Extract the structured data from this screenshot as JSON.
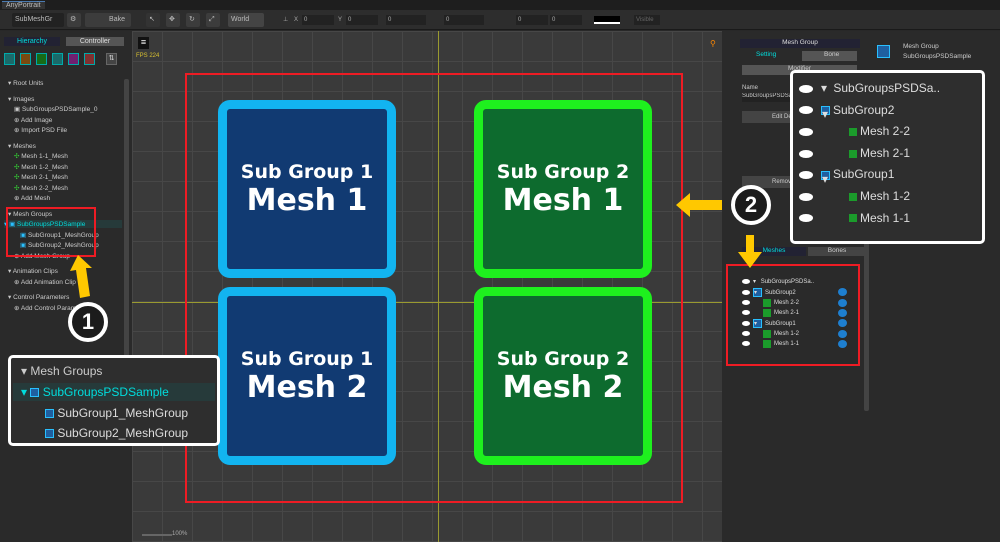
{
  "window": {
    "title": "AnyPortrait"
  },
  "toolbar": {
    "mesh_group_select": "SubMeshGr",
    "bake": "Bake",
    "space": "World",
    "pos_x": "0",
    "pos_y": "0",
    "scale": "0",
    "rotation": "0",
    "size_x": "0",
    "size_y": "0",
    "visible": "Visible",
    "x": "X",
    "y": "Y"
  },
  "left_panel": {
    "tabs": [
      "Hierarchy",
      "Controller"
    ],
    "tree": [
      {
        "label": "Root Units",
        "type": "header"
      },
      {
        "label": "Images",
        "type": "header"
      },
      {
        "label": "SubGroupsPSDSample_0",
        "type": "image"
      },
      {
        "label": "Add Image",
        "type": "add"
      },
      {
        "label": "Import PSD File",
        "type": "add"
      },
      {
        "label": "Meshes",
        "type": "header"
      },
      {
        "label": "Mesh 1-1_Mesh",
        "type": "mesh"
      },
      {
        "label": "Mesh 1-2_Mesh",
        "type": "mesh"
      },
      {
        "label": "Mesh 2-1_Mesh",
        "type": "mesh"
      },
      {
        "label": "Mesh 2-2_Mesh",
        "type": "mesh"
      },
      {
        "label": "Add Mesh",
        "type": "add"
      },
      {
        "label": "Mesh Groups",
        "type": "header"
      },
      {
        "label": "SubGroupsPSDSample",
        "type": "selected"
      },
      {
        "label": "SubGroup1_MeshGroup",
        "type": "meshgroup"
      },
      {
        "label": "SubGroup2_MeshGroup",
        "type": "meshgroup"
      },
      {
        "label": "Add Mesh Group",
        "type": "add"
      },
      {
        "label": "Animation Clips",
        "type": "header"
      },
      {
        "label": "Add Animation Clip",
        "type": "add"
      },
      {
        "label": "Control Parameters",
        "type": "header"
      },
      {
        "label": "Add Control Parameter",
        "type": "add"
      }
    ]
  },
  "canvas": {
    "fps": "FPS 224",
    "zoom": "100%",
    "tiles": [
      {
        "line1": "Sub Group 1",
        "line2": "Mesh 1",
        "color": "blue"
      },
      {
        "line1": "Sub Group 2",
        "line2": "Mesh 1",
        "color": "green"
      },
      {
        "line1": "Sub Group 1",
        "line2": "Mesh 2",
        "color": "blue"
      },
      {
        "line1": "Sub Group 2",
        "line2": "Mesh 2",
        "color": "green"
      }
    ]
  },
  "right_panel": {
    "header": "Mesh Group",
    "tabs": [
      "Setting",
      "Bone"
    ],
    "modifier": "Modifier",
    "name_label": "Name",
    "name_value": "SubGroupsPSDSample",
    "edit_btn": "Edit Default Transform",
    "remove_btn": "Remove",
    "list_tabs": [
      "Meshes",
      "Bones"
    ],
    "info_title": "Mesh Group",
    "info_name": "SubGroupsPSDSample",
    "list": [
      {
        "label": "SubGroupsPSDSa..",
        "indent": 0,
        "kind": "root"
      },
      {
        "label": "SubGroup2",
        "indent": 1,
        "kind": "group"
      },
      {
        "label": "Mesh 2-2",
        "indent": 2,
        "kind": "mesh"
      },
      {
        "label": "Mesh 2-1",
        "indent": 2,
        "kind": "mesh"
      },
      {
        "label": "SubGroup1",
        "indent": 1,
        "kind": "group"
      },
      {
        "label": "Mesh 1-2",
        "indent": 2,
        "kind": "mesh"
      },
      {
        "label": "Mesh 1-1",
        "indent": 2,
        "kind": "mesh"
      }
    ]
  },
  "callout1": {
    "number": "1",
    "items": [
      "Mesh Groups",
      "SubGroupsPSDSample",
      "SubGroup1_MeshGroup",
      "SubGroup2_MeshGroup"
    ]
  },
  "callout2": {
    "number": "2"
  },
  "colors": {
    "highlight_red": "#ee1c24",
    "arrow_yellow": "#ffc800",
    "accent_cyan": "#00d8d8"
  }
}
